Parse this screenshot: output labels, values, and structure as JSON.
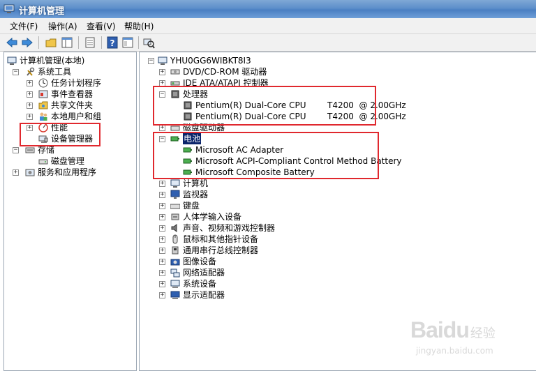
{
  "window": {
    "title": "计算机管理"
  },
  "menu": [
    "文件(F)",
    "操作(A)",
    "查看(V)",
    "帮助(H)"
  ],
  "left_tree": [
    {
      "label": "计算机管理(本地)",
      "icon": "computer-management-icon",
      "expander": ""
    },
    {
      "label": "系统工具",
      "icon": "system-tools-icon",
      "expander": "−"
    },
    {
      "label": "任务计划程序",
      "icon": "clock-icon",
      "expander": "+"
    },
    {
      "label": "事件查看器",
      "icon": "event-viewer-icon",
      "expander": "+"
    },
    {
      "label": "共享文件夹",
      "icon": "shared-folder-icon",
      "expander": "+"
    },
    {
      "label": "本地用户和组",
      "icon": "users-icon",
      "expander": "+"
    },
    {
      "label": "性能",
      "icon": "performance-icon",
      "expander": "+"
    },
    {
      "label": "设备管理器",
      "icon": "device-manager-icon",
      "expander": ""
    },
    {
      "label": "存储",
      "icon": "storage-icon",
      "expander": "−"
    },
    {
      "label": "磁盘管理",
      "icon": "disk-management-icon",
      "expander": ""
    },
    {
      "label": "服务和应用程序",
      "icon": "services-icon",
      "expander": "+"
    }
  ],
  "device_tree": {
    "root": "YHU0GG6WIBKT8I3",
    "items": [
      {
        "label": "DVD/CD-ROM 驱动器",
        "icon": "dvd-drive-icon",
        "expander": "+"
      },
      {
        "label": "IDE ATA/ATAPI 控制器",
        "icon": "ide-controller-icon",
        "expander": "+"
      },
      {
        "label": "处理器",
        "icon": "processor-icon",
        "expander": "−"
      },
      {
        "label": "Pentium(R) Dual-Core CPU        T4200  @ 2.00GHz",
        "icon": "cpu-icon",
        "expander": ""
      },
      {
        "label": "Pentium(R) Dual-Core CPU        T4200  @ 2.00GHz",
        "icon": "cpu-icon",
        "expander": ""
      },
      {
        "label": "磁盘驱动器",
        "icon": "disk-drive-icon",
        "expander": "+"
      },
      {
        "label": "电池",
        "icon": "battery-icon",
        "expander": "−"
      },
      {
        "label": "Microsoft AC Adapter",
        "icon": "battery-device-icon",
        "expander": ""
      },
      {
        "label": "Microsoft ACPI-Compliant Control Method Battery",
        "icon": "battery-device-icon",
        "expander": ""
      },
      {
        "label": "Microsoft Composite Battery",
        "icon": "battery-device-icon",
        "expander": ""
      },
      {
        "label": "计算机",
        "icon": "computer-icon",
        "expander": "+"
      },
      {
        "label": "监视器",
        "icon": "monitor-icon",
        "expander": "+"
      },
      {
        "label": "键盘",
        "icon": "keyboard-icon",
        "expander": "+"
      },
      {
        "label": "人体学输入设备",
        "icon": "hid-icon",
        "expander": "+"
      },
      {
        "label": "声音、视频和游戏控制器",
        "icon": "sound-icon",
        "expander": "+"
      },
      {
        "label": "鼠标和其他指针设备",
        "icon": "mouse-icon",
        "expander": "+"
      },
      {
        "label": "通用串行总线控制器",
        "icon": "usb-icon",
        "expander": "+"
      },
      {
        "label": "图像设备",
        "icon": "camera-icon",
        "expander": "+"
      },
      {
        "label": "网络适配器",
        "icon": "network-icon",
        "expander": "+"
      },
      {
        "label": "系统设备",
        "icon": "system-device-icon",
        "expander": "+"
      },
      {
        "label": "显示适配器",
        "icon": "display-adapter-icon",
        "expander": "+"
      }
    ]
  },
  "watermark": {
    "brand": "Baidu",
    "suffix": "经验",
    "url": "jingyan.baidu.com"
  },
  "colors": {
    "highlight": "#e0282e",
    "titlebar": "#4a7fc2"
  }
}
